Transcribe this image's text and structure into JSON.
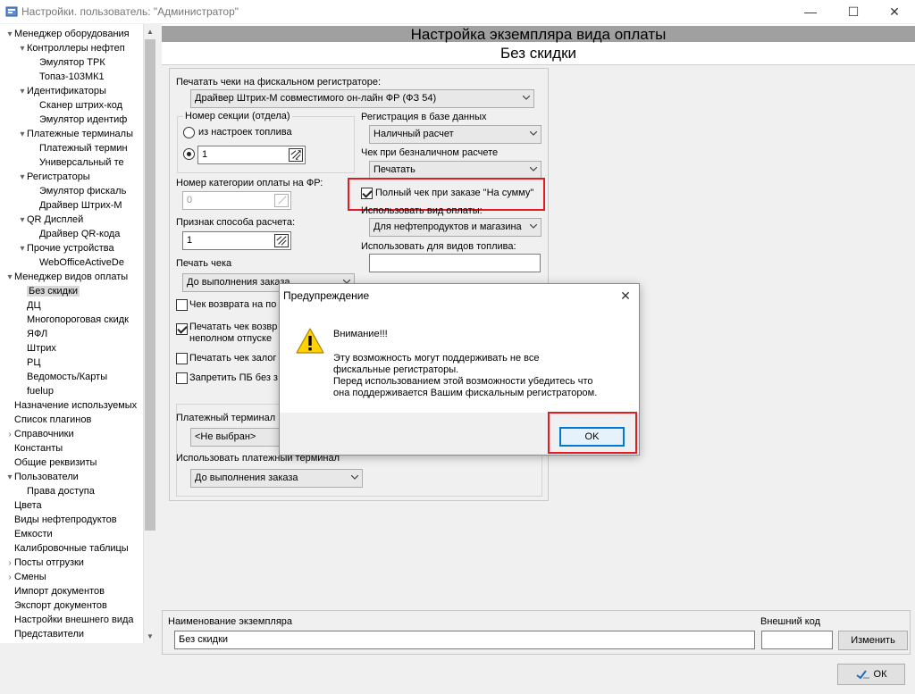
{
  "window": {
    "title": "Настройки. пользователь: \"Администратор\""
  },
  "tree": [
    {
      "label": "Менеджер оборудования",
      "level": 0,
      "expander": "minus"
    },
    {
      "label": "Контроллеры нефтеп",
      "level": 1,
      "expander": "minus"
    },
    {
      "label": "Эмулятор ТРК",
      "level": 2,
      "expander": ""
    },
    {
      "label": "Топаз-103МК1",
      "level": 2,
      "expander": ""
    },
    {
      "label": "Идентификаторы",
      "level": 1,
      "expander": "minus"
    },
    {
      "label": "Сканер штрих-код",
      "level": 2,
      "expander": ""
    },
    {
      "label": "Эмулятор идентиф",
      "level": 2,
      "expander": ""
    },
    {
      "label": "Платежные терминалы",
      "level": 1,
      "expander": "minus"
    },
    {
      "label": "Платежный термин",
      "level": 2,
      "expander": ""
    },
    {
      "label": "Универсальный те",
      "level": 2,
      "expander": ""
    },
    {
      "label": "Регистраторы",
      "level": 1,
      "expander": "minus"
    },
    {
      "label": "Эмулятор фискаль",
      "level": 2,
      "expander": ""
    },
    {
      "label": "Драйвер Штрих-М",
      "level": 2,
      "expander": ""
    },
    {
      "label": "QR Дисплей",
      "level": 1,
      "expander": "minus"
    },
    {
      "label": "Драйвер QR-кода",
      "level": 2,
      "expander": ""
    },
    {
      "label": "Прочие устройства",
      "level": 1,
      "expander": "minus"
    },
    {
      "label": "WebOfficeActiveDe",
      "level": 2,
      "expander": ""
    },
    {
      "label": "Менеджер видов оплаты",
      "level": 0,
      "expander": "minus"
    },
    {
      "label": "Без скидки",
      "level": 1,
      "expander": "",
      "selected": true
    },
    {
      "label": "ДЦ",
      "level": 1,
      "expander": ""
    },
    {
      "label": "Многопороговая скидк",
      "level": 1,
      "expander": ""
    },
    {
      "label": "ЯФЛ",
      "level": 1,
      "expander": ""
    },
    {
      "label": "Штрих",
      "level": 1,
      "expander": ""
    },
    {
      "label": "РЦ",
      "level": 1,
      "expander": ""
    },
    {
      "label": "Ведомость/Карты",
      "level": 1,
      "expander": ""
    },
    {
      "label": "fuelup",
      "level": 1,
      "expander": ""
    },
    {
      "label": "Назначение используемых",
      "level": 0,
      "expander": ""
    },
    {
      "label": "Список плагинов",
      "level": 0,
      "expander": ""
    },
    {
      "label": "Справочники",
      "level": 0,
      "expander": "plus"
    },
    {
      "label": "Константы",
      "level": 0,
      "expander": ""
    },
    {
      "label": "Общие реквизиты",
      "level": 0,
      "expander": ""
    },
    {
      "label": "Пользователи",
      "level": 0,
      "expander": "minus"
    },
    {
      "label": "Права доступа",
      "level": 1,
      "expander": ""
    },
    {
      "label": "Цвета",
      "level": 0,
      "expander": ""
    },
    {
      "label": "Виды нефтепродуктов",
      "level": 0,
      "expander": ""
    },
    {
      "label": "Емкости",
      "level": 0,
      "expander": ""
    },
    {
      "label": "Калибровочные таблицы",
      "level": 0,
      "expander": ""
    },
    {
      "label": "Посты отгрузки",
      "level": 0,
      "expander": "plus"
    },
    {
      "label": "Смены",
      "level": 0,
      "expander": "plus"
    },
    {
      "label": "Импорт документов",
      "level": 0,
      "expander": ""
    },
    {
      "label": "Экспорт документов",
      "level": 0,
      "expander": ""
    },
    {
      "label": "Настройки внешнего вида",
      "level": 0,
      "expander": ""
    },
    {
      "label": "Представители",
      "level": 0,
      "expander": ""
    }
  ],
  "header": {
    "title": "Настройка экземпляра вида оплаты",
    "subtitle": "Без скидки"
  },
  "settings": {
    "fiscal_label": "Печатать чеки на фискальном регистраторе:",
    "fiscal_value": "Драйвер Штрих-М совместимого он-лайн ФР (ФЗ 54)",
    "section_group": "Номер секции (отдела)",
    "section_radio1": "из настроек топлива",
    "section_value": "1",
    "category_label": "Номер категории оплаты на ФР:",
    "category_value": "0",
    "calc_label": "Признак способа расчета:",
    "calc_value": "1",
    "print_label": "Печать чека",
    "print_value": "До выполнения заказа",
    "chk_return": "Чек возврата на по",
    "chk_print_return_1": "Печатать чек возвр",
    "chk_print_return_2": "неполном отпуске",
    "chk_pledge": "Печатать чек залог",
    "chk_forbid": "Запретить ПБ без з",
    "db_label": "Регистрация в базе данных",
    "db_value": "Наличный расчет",
    "cashless_label": "Чек при безналичном расчете",
    "cashless_value": "Печатать",
    "full_check": "Полный чек при заказе \"На сумму\"",
    "use_type_label": "Использовать вид оплаты:",
    "use_type_value": "Для нефтепродуктов и магазина",
    "fuel_types_label": "Использовать для видов топлива:",
    "fuel_types_value": "",
    "terminal_label": "Платежный терминал",
    "terminal_value": "<Не выбран>",
    "use_terminal_label": "Использовать платежный терминал",
    "use_terminal_value": "До выполнения заказа"
  },
  "dialog": {
    "title": "Предупреждение",
    "heading": "Внимание!!!",
    "line1": "Эту возможность могут поддерживать не все",
    "line2": "фискальные регистраторы.",
    "line3": "Перед использованием этой возможности убедитесь что",
    "line4": "она поддерживается Вашим фискальным регистратором.",
    "ok_label": "OK",
    "close_glyph": "✕"
  },
  "bottom": {
    "name_label": "Наименование экземпляра",
    "name_value": "Без скидки",
    "code_label": "Внешний код",
    "code_value": "",
    "change_label": "Изменить",
    "ok_label": "ОК"
  },
  "colors": {
    "highlight_red": "#e41b23",
    "dialog_ok_border": "#0078d7",
    "header_band": "#a0a0a0"
  }
}
